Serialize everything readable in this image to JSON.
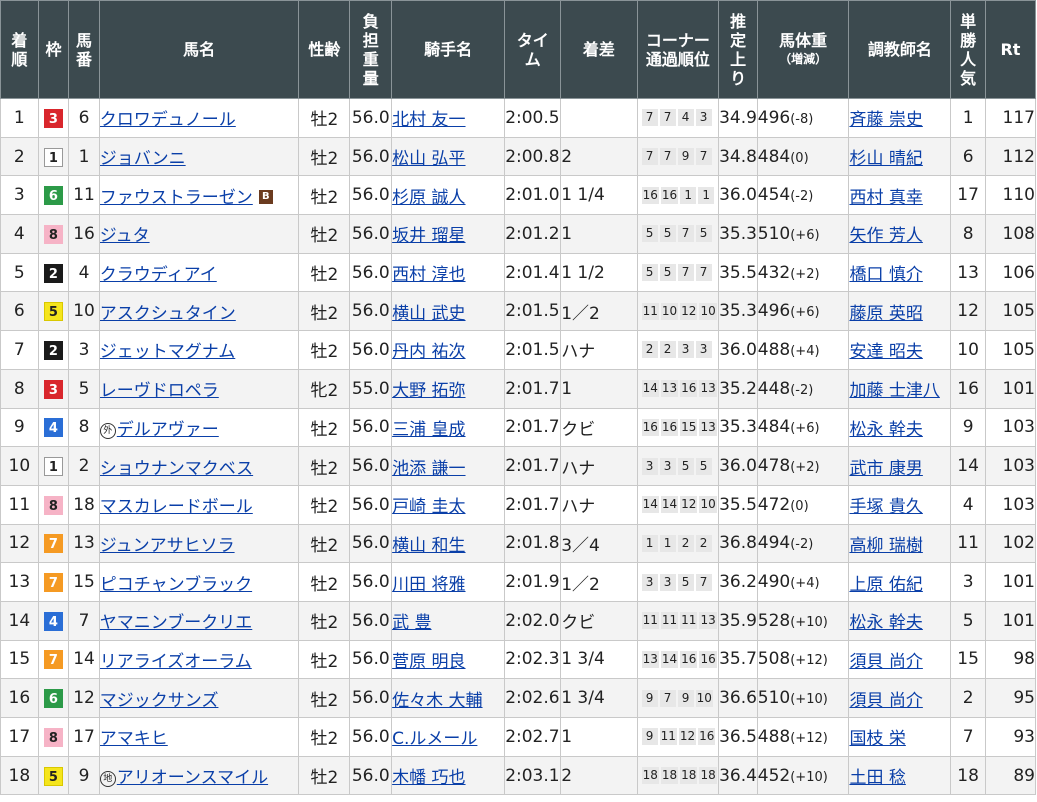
{
  "headers": {
    "chakujun": "着順",
    "waku": "枠",
    "umaban": "馬番",
    "bamei": "馬名",
    "seirei": "性齢",
    "kinryo": "負担重量",
    "kishu": "騎手名",
    "time": "タイム",
    "chakusa": "着差",
    "corner": "コーナー通過順位",
    "agari": "推定上り",
    "bataiju": "馬体重",
    "bataiju_sub": "（増減）",
    "chokyoshi": "調教師名",
    "ninki": "単勝人気",
    "rt": "Rt"
  },
  "waku_colors": {
    "1": {
      "bg": "#ffffff",
      "fg": "#222222",
      "border": "#999999"
    },
    "2": {
      "bg": "#1a1a1a",
      "fg": "#ffffff",
      "border": "#1a1a1a"
    },
    "3": {
      "bg": "#d9262c",
      "fg": "#ffffff",
      "border": "#d9262c"
    },
    "4": {
      "bg": "#2a6ed6",
      "fg": "#ffffff",
      "border": "#2a6ed6"
    },
    "5": {
      "bg": "#f5e51c",
      "fg": "#222222",
      "border": "#d9c800"
    },
    "6": {
      "bg": "#2c9a48",
      "fg": "#ffffff",
      "border": "#2c9a48"
    },
    "7": {
      "bg": "#f59a23",
      "fg": "#ffffff",
      "border": "#f59a23"
    },
    "8": {
      "bg": "#f6b3c6",
      "fg": "#222222",
      "border": "#f6b3c6"
    }
  },
  "rows": [
    {
      "chakujun": "1",
      "waku": "3",
      "umaban": "6",
      "bamei": "クロワデュノール",
      "mark": "",
      "seirei": "牡2",
      "kinryo": "56.0",
      "kishu": "北村 友一",
      "time": "2:00.5",
      "chakusa": "",
      "corner": [
        "7",
        "7",
        "4",
        "3"
      ],
      "agari": "34.9",
      "weight": "496",
      "diff": "(-8)",
      "chokyoshi": "斉藤 崇史",
      "ninki": "1",
      "rt": "117"
    },
    {
      "chakujun": "2",
      "waku": "1",
      "umaban": "1",
      "bamei": "ジョバンニ",
      "mark": "",
      "seirei": "牡2",
      "kinryo": "56.0",
      "kishu": "松山 弘平",
      "time": "2:00.8",
      "chakusa": "2",
      "corner": [
        "7",
        "7",
        "9",
        "7"
      ],
      "agari": "34.8",
      "weight": "484",
      "diff": "(0)",
      "chokyoshi": "杉山 晴紀",
      "ninki": "6",
      "rt": "112"
    },
    {
      "chakujun": "3",
      "waku": "6",
      "umaban": "11",
      "bamei": "ファウストラーゼン",
      "mark": "B",
      "seirei": "牡2",
      "kinryo": "56.0",
      "kishu": "杉原 誠人",
      "time": "2:01.0",
      "chakusa": "1 1/4",
      "corner": [
        "16",
        "16",
        "1",
        "1"
      ],
      "agari": "36.0",
      "weight": "454",
      "diff": "(-2)",
      "chokyoshi": "西村 真幸",
      "ninki": "17",
      "rt": "110"
    },
    {
      "chakujun": "4",
      "waku": "8",
      "umaban": "16",
      "bamei": "ジュタ",
      "mark": "",
      "seirei": "牡2",
      "kinryo": "56.0",
      "kishu": "坂井 瑠星",
      "time": "2:01.2",
      "chakusa": "1",
      "corner": [
        "5",
        "5",
        "7",
        "5"
      ],
      "agari": "35.3",
      "weight": "510",
      "diff": "(+6)",
      "chokyoshi": "矢作 芳人",
      "ninki": "8",
      "rt": "108"
    },
    {
      "chakujun": "5",
      "waku": "2",
      "umaban": "4",
      "bamei": "クラウディアイ",
      "mark": "",
      "seirei": "牡2",
      "kinryo": "56.0",
      "kishu": "西村 淳也",
      "time": "2:01.4",
      "chakusa": "1 1/2",
      "corner": [
        "5",
        "5",
        "7",
        "7"
      ],
      "agari": "35.5",
      "weight": "432",
      "diff": "(+2)",
      "chokyoshi": "橋口 慎介",
      "ninki": "13",
      "rt": "106"
    },
    {
      "chakujun": "6",
      "waku": "5",
      "umaban": "10",
      "bamei": "アスクシュタイン",
      "mark": "",
      "seirei": "牡2",
      "kinryo": "56.0",
      "kishu": "横山 武史",
      "time": "2:01.5",
      "chakusa": "1／2",
      "corner": [
        "11",
        "10",
        "12",
        "10"
      ],
      "agari": "35.3",
      "weight": "496",
      "diff": "(+6)",
      "chokyoshi": "藤原 英昭",
      "ninki": "12",
      "rt": "105"
    },
    {
      "chakujun": "7",
      "waku": "2",
      "umaban": "3",
      "bamei": "ジェットマグナム",
      "mark": "",
      "seirei": "牡2",
      "kinryo": "56.0",
      "kishu": "丹内 祐次",
      "time": "2:01.5",
      "chakusa": "ハナ",
      "corner": [
        "2",
        "2",
        "3",
        "3"
      ],
      "agari": "36.0",
      "weight": "488",
      "diff": "(+4)",
      "chokyoshi": "安達 昭夫",
      "ninki": "10",
      "rt": "105"
    },
    {
      "chakujun": "8",
      "waku": "3",
      "umaban": "5",
      "bamei": "レーヴドロペラ",
      "mark": "",
      "seirei": "牝2",
      "kinryo": "55.0",
      "kishu": "大野 拓弥",
      "time": "2:01.7",
      "chakusa": "1",
      "corner": [
        "14",
        "13",
        "16",
        "13"
      ],
      "agari": "35.2",
      "weight": "448",
      "diff": "(-2)",
      "chokyoshi": "加藤 士津八",
      "ninki": "16",
      "rt": "101"
    },
    {
      "chakujun": "9",
      "waku": "4",
      "umaban": "8",
      "bamei": "デルアヴァー",
      "mark": "外",
      "seirei": "牡2",
      "kinryo": "56.0",
      "kishu": "三浦 皇成",
      "time": "2:01.7",
      "chakusa": "クビ",
      "corner": [
        "16",
        "16",
        "15",
        "13"
      ],
      "agari": "35.3",
      "weight": "484",
      "diff": "(+6)",
      "chokyoshi": "松永 幹夫",
      "ninki": "9",
      "rt": "103"
    },
    {
      "chakujun": "10",
      "waku": "1",
      "umaban": "2",
      "bamei": "ショウナンマクベス",
      "mark": "",
      "seirei": "牡2",
      "kinryo": "56.0",
      "kishu": "池添 謙一",
      "time": "2:01.7",
      "chakusa": "ハナ",
      "corner": [
        "3",
        "3",
        "5",
        "5"
      ],
      "agari": "36.0",
      "weight": "478",
      "diff": "(+2)",
      "chokyoshi": "武市 康男",
      "ninki": "14",
      "rt": "103"
    },
    {
      "chakujun": "11",
      "waku": "8",
      "umaban": "18",
      "bamei": "マスカレードボール",
      "mark": "",
      "seirei": "牡2",
      "kinryo": "56.0",
      "kishu": "戸崎 圭太",
      "time": "2:01.7",
      "chakusa": "ハナ",
      "corner": [
        "14",
        "14",
        "12",
        "10"
      ],
      "agari": "35.5",
      "weight": "472",
      "diff": "(0)",
      "chokyoshi": "手塚 貴久",
      "ninki": "4",
      "rt": "103"
    },
    {
      "chakujun": "12",
      "waku": "7",
      "umaban": "13",
      "bamei": "ジュンアサヒソラ",
      "mark": "",
      "seirei": "牡2",
      "kinryo": "56.0",
      "kishu": "横山 和生",
      "time": "2:01.8",
      "chakusa": "3／4",
      "corner": [
        "1",
        "1",
        "2",
        "2"
      ],
      "agari": "36.8",
      "weight": "494",
      "diff": "(-2)",
      "chokyoshi": "高柳 瑞樹",
      "ninki": "11",
      "rt": "102"
    },
    {
      "chakujun": "13",
      "waku": "7",
      "umaban": "15",
      "bamei": "ピコチャンブラック",
      "mark": "",
      "seirei": "牡2",
      "kinryo": "56.0",
      "kishu": "川田 将雅",
      "time": "2:01.9",
      "chakusa": "1／2",
      "corner": [
        "3",
        "3",
        "5",
        "7"
      ],
      "agari": "36.2",
      "weight": "490",
      "diff": "(+4)",
      "chokyoshi": "上原 佑紀",
      "ninki": "3",
      "rt": "101"
    },
    {
      "chakujun": "14",
      "waku": "4",
      "umaban": "7",
      "bamei": "ヤマニンブークリエ",
      "mark": "",
      "seirei": "牡2",
      "kinryo": "56.0",
      "kishu": "武 豊",
      "time": "2:02.0",
      "chakusa": "クビ",
      "corner": [
        "11",
        "11",
        "11",
        "13"
      ],
      "agari": "35.9",
      "weight": "528",
      "diff": "(+10)",
      "chokyoshi": "松永 幹夫",
      "ninki": "5",
      "rt": "101"
    },
    {
      "chakujun": "15",
      "waku": "7",
      "umaban": "14",
      "bamei": "リアライズオーラム",
      "mark": "",
      "seirei": "牡2",
      "kinryo": "56.0",
      "kishu": "菅原 明良",
      "time": "2:02.3",
      "chakusa": "1 3/4",
      "corner": [
        "13",
        "14",
        "16",
        "16"
      ],
      "agari": "35.7",
      "weight": "508",
      "diff": "(+12)",
      "chokyoshi": "須貝 尚介",
      "ninki": "15",
      "rt": "98"
    },
    {
      "chakujun": "16",
      "waku": "6",
      "umaban": "12",
      "bamei": "マジックサンズ",
      "mark": "",
      "seirei": "牡2",
      "kinryo": "56.0",
      "kishu": "佐々木 大輔",
      "time": "2:02.6",
      "chakusa": "1 3/4",
      "corner": [
        "9",
        "7",
        "9",
        "10"
      ],
      "agari": "36.6",
      "weight": "510",
      "diff": "(+10)",
      "chokyoshi": "須貝 尚介",
      "ninki": "2",
      "rt": "95"
    },
    {
      "chakujun": "17",
      "waku": "8",
      "umaban": "17",
      "bamei": "アマキヒ",
      "mark": "",
      "seirei": "牡2",
      "kinryo": "56.0",
      "kishu": "C.ルメール",
      "time": "2:02.7",
      "chakusa": "1",
      "corner": [
        "9",
        "11",
        "12",
        "16"
      ],
      "agari": "36.5",
      "weight": "488",
      "diff": "(+12)",
      "chokyoshi": "国枝 栄",
      "ninki": "7",
      "rt": "93"
    },
    {
      "chakujun": "18",
      "waku": "5",
      "umaban": "9",
      "bamei": "アリオーンスマイル",
      "mark": "地",
      "seirei": "牡2",
      "kinryo": "56.0",
      "kishu": "木幡 巧也",
      "time": "2:03.1",
      "chakusa": "2",
      "corner": [
        "18",
        "18",
        "18",
        "18"
      ],
      "agari": "36.4",
      "weight": "452",
      "diff": "(+10)",
      "chokyoshi": "土田 稔",
      "ninki": "18",
      "rt": "89"
    }
  ]
}
